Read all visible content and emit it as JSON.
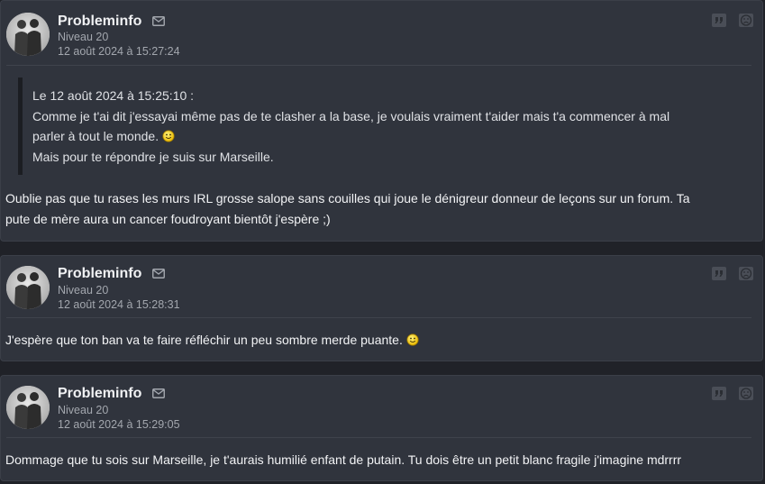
{
  "colors": {
    "page_background": "#202228",
    "card_background": "#30343d",
    "author_text": "#f0f1f3",
    "meta_text": "#a3a7ae",
    "quote_bar": "#1b1d22",
    "smiley": "#f5d21a"
  },
  "icons": {
    "mail": "mail-icon",
    "quote": "quote-icon",
    "report": "sad-face-icon",
    "smiley": "smiley-icon",
    "avatar": "avatar-silhouettes"
  },
  "posts": [
    {
      "author": "Probleminfo",
      "level": "Niveau 20",
      "date": "12 août 2024 à 15:27:24",
      "quote": {
        "header": "Le 12 août 2024 à 15:25:10 :",
        "line1": "Comme je t'ai dit j'essayai même pas de te clasher a la base, je voulais vraiment t'aider mais t'a commencer à mal",
        "line2": "parler à tout le monde.",
        "line3": "Mais pour te répondre je suis sur Marseille."
      },
      "body_line1": "Oublie pas que tu rases les murs IRL grosse salope sans couilles qui joue le dénigreur donneur de leçons sur un forum. Ta",
      "body_line2": "pute de mère aura un cancer foudroyant bientôt j'espère ;)"
    },
    {
      "author": "Probleminfo",
      "level": "Niveau 20",
      "date": "12 août 2024 à 15:28:31",
      "body_line1": "J'espère que ton ban va te faire réfléchir un peu sombre merde puante."
    },
    {
      "author": "Probleminfo",
      "level": "Niveau 20",
      "date": "12 août 2024 à 15:29:05",
      "body_line1": "Dommage que tu sois sur Marseille, je t'aurais humilié enfant de putain. Tu dois être un petit blanc fragile j'imagine mdrrrr"
    }
  ]
}
